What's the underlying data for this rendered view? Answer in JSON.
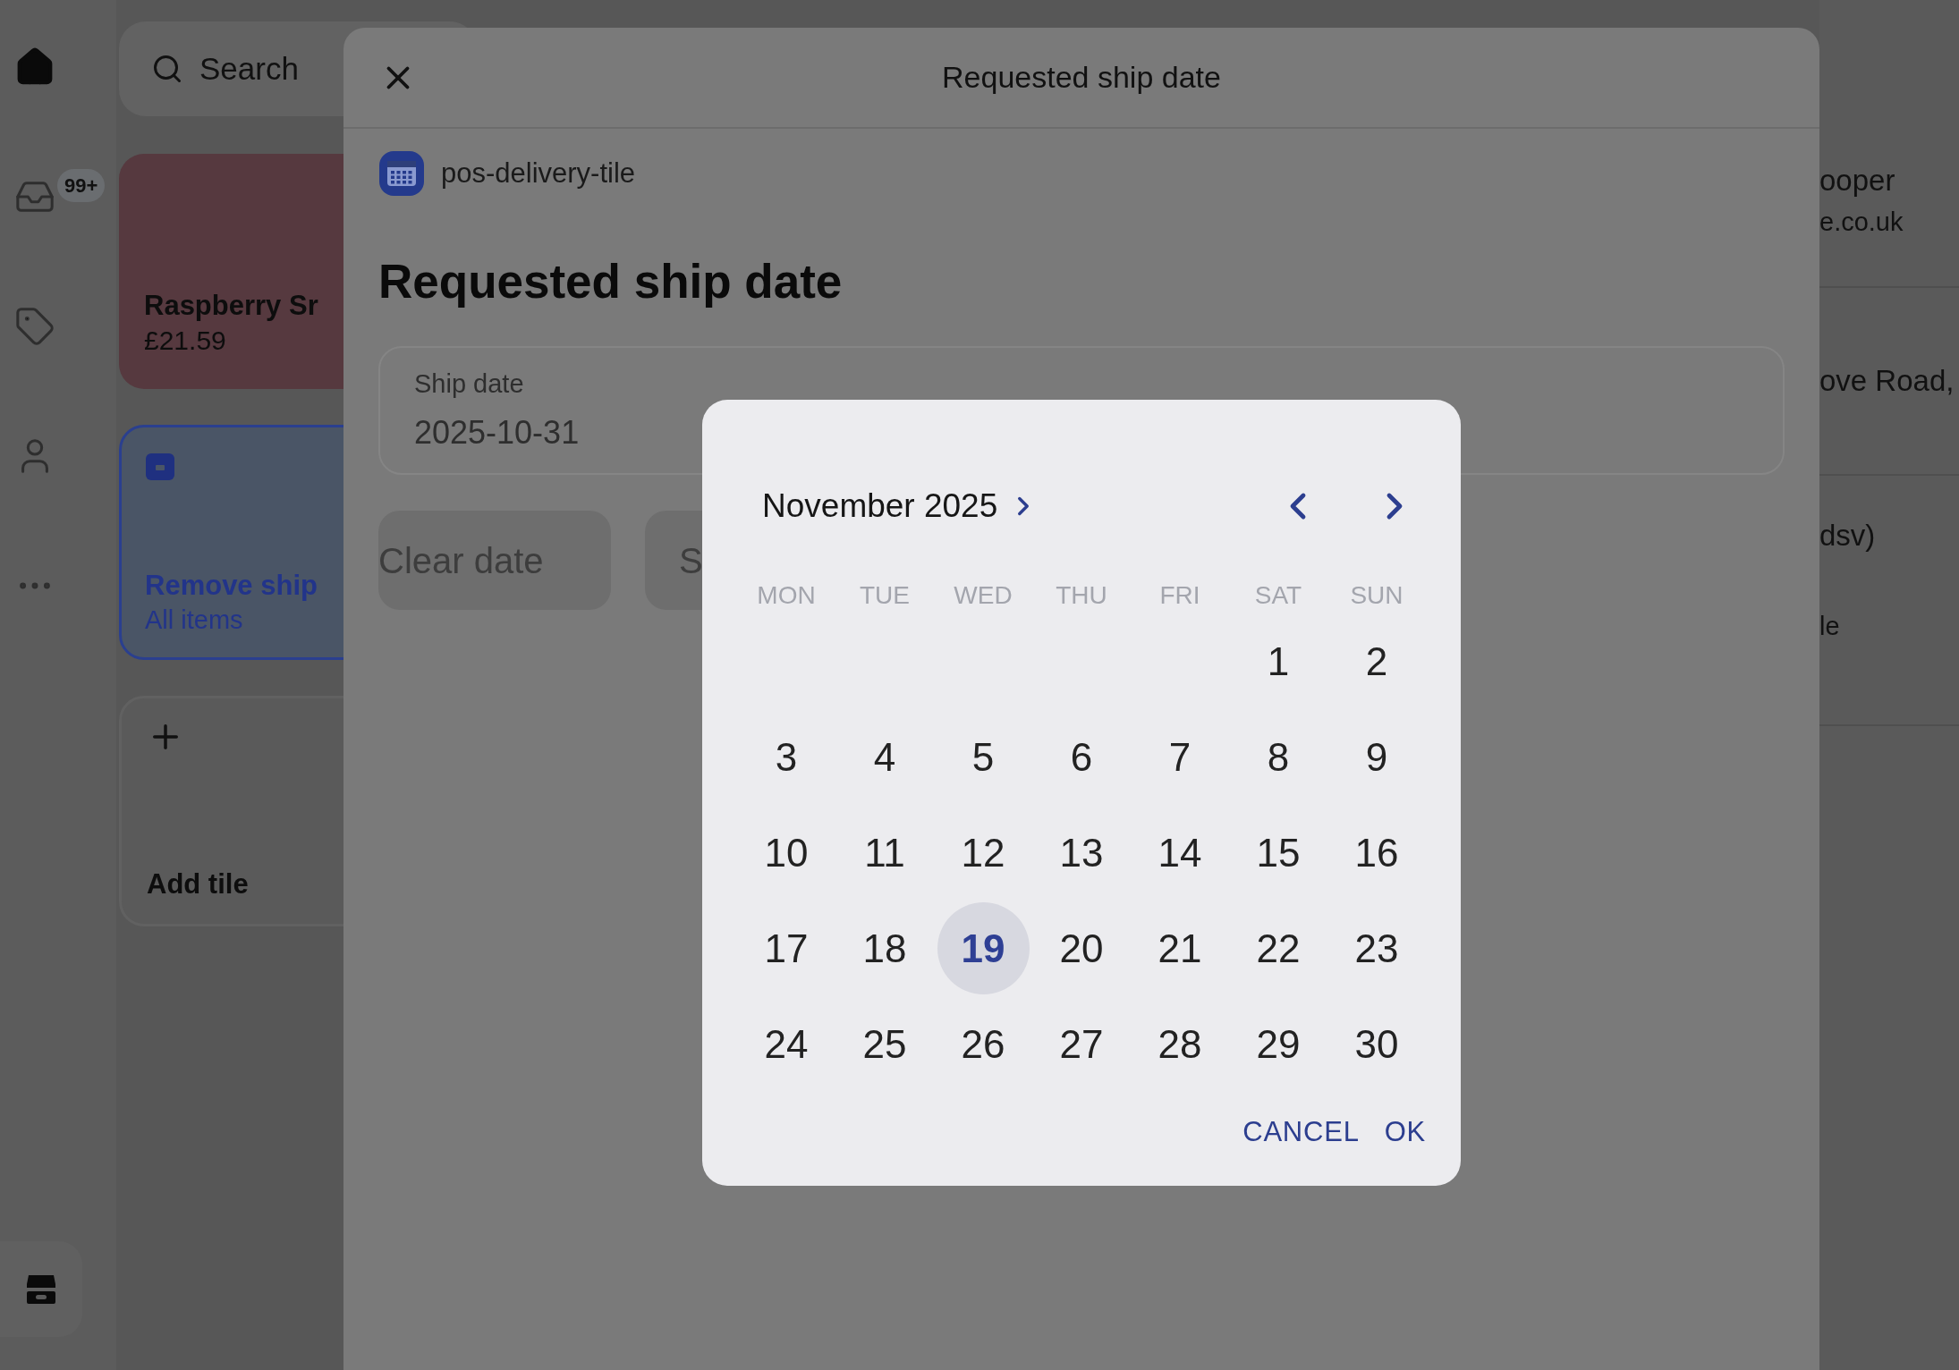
{
  "rail": {
    "items": [
      {
        "selected": true
      },
      {
        "selected": false,
        "badge": "99+"
      },
      {
        "selected": false
      },
      {
        "selected": false
      },
      {
        "selected": false
      }
    ]
  },
  "search": {
    "placeholder": "Search"
  },
  "tiles": [
    {
      "kind": "product",
      "title": "Raspberry Sr",
      "subtitle": "£21.59",
      "selected": false
    },
    {
      "kind": "action",
      "title": "Remove ship",
      "subtitle": "All items",
      "selected": true
    },
    {
      "kind": "add",
      "title": "Add tile",
      "selected": false
    }
  ],
  "customer_panel": {
    "rows": [
      {
        "lines": [
          "ooper",
          "e.co.uk"
        ]
      },
      {
        "lines": [
          "ove Road,"
        ]
      },
      {
        "lines": [
          "dsv)",
          "le"
        ]
      }
    ]
  },
  "modal": {
    "title": "Requested ship date",
    "source": "pos-delivery-tile",
    "heading": "Requested ship date",
    "field": {
      "label": "Ship date",
      "value": "2025-10-31"
    },
    "buttons": [
      "Clear date",
      "S"
    ]
  },
  "date_picker": {
    "month": "November 2025",
    "weekdays": [
      "MON",
      "TUE",
      "WED",
      "THU",
      "FRI",
      "SAT",
      "SUN"
    ],
    "weeks": [
      {
        "days": [
          {
            "label": "1",
            "selected": false
          },
          {
            "label": "2",
            "selected": false
          }
        ]
      },
      {
        "days": [
          {
            "label": "3",
            "selected": false
          },
          {
            "label": "4",
            "selected": false
          },
          {
            "label": "5",
            "selected": false
          },
          {
            "label": "6",
            "selected": false
          },
          {
            "label": "7",
            "selected": false
          },
          {
            "label": "8",
            "selected": false
          },
          {
            "label": "9",
            "selected": false
          }
        ]
      },
      {
        "days": [
          {
            "label": "10",
            "selected": false
          },
          {
            "label": "11",
            "selected": false
          },
          {
            "label": "12",
            "selected": false
          },
          {
            "label": "13",
            "selected": false
          },
          {
            "label": "14",
            "selected": false
          },
          {
            "label": "15",
            "selected": false
          },
          {
            "label": "16",
            "selected": false
          }
        ]
      },
      {
        "days": [
          {
            "label": "17",
            "selected": false
          },
          {
            "label": "18",
            "selected": false
          },
          {
            "label": "19",
            "selected": true
          },
          {
            "label": "20",
            "selected": false
          },
          {
            "label": "21",
            "selected": false
          },
          {
            "label": "22",
            "selected": false
          },
          {
            "label": "23",
            "selected": false
          }
        ]
      },
      {
        "days": [
          {
            "label": "24",
            "selected": false
          },
          {
            "label": "25",
            "selected": false
          },
          {
            "label": "26",
            "selected": false
          },
          {
            "label": "27",
            "selected": false
          },
          {
            "label": "28",
            "selected": false
          },
          {
            "label": "29",
            "selected": false
          },
          {
            "label": "30",
            "selected": false
          }
        ]
      }
    ],
    "actions": [
      "CANCEL",
      "OK"
    ]
  }
}
